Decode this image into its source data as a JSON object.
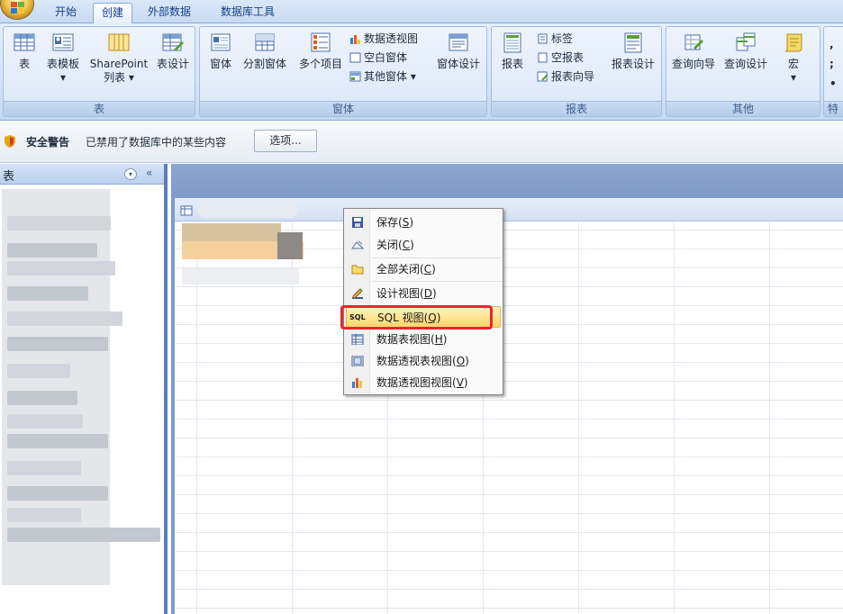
{
  "tabs": [
    {
      "label": "开始"
    },
    {
      "label": "创建"
    },
    {
      "label": "外部数据"
    },
    {
      "label": "数据库工具"
    }
  ],
  "ribbon": {
    "groups": [
      {
        "title": "表"
      },
      {
        "title": "窗体"
      },
      {
        "title": "报表"
      },
      {
        "title": "其他"
      },
      {
        "title": "特"
      }
    ],
    "table_group": {
      "table": "表",
      "table_template": "表模板",
      "table_template_arrow": "▾",
      "sharepoint_1": "SharePoint",
      "sharepoint_2": "列表 ▾",
      "table_design": "表设计"
    },
    "form_group": {
      "form": "窗体",
      "split_form": "分割窗体",
      "multi_items": "多个项目",
      "pivot_chart": "数据透视图",
      "blank_form": "空白窗体",
      "more_forms": "其他窗体 ▾",
      "form_design": "窗体设计"
    },
    "report_group": {
      "report": "报表",
      "labels": "标签",
      "blank_report": "空报表",
      "report_wizard": "报表向导",
      "report_design": "报表设计"
    },
    "other_group": {
      "query_wizard": "查询向导",
      "query_design": "查询设计",
      "macro": "宏",
      "macro_arrow": "▾"
    }
  },
  "message_bar": {
    "title": "安全警告",
    "text": "已禁用了数据库中的某些内容",
    "options": "选项..."
  },
  "nav_pane": {
    "title": "表",
    "dropdown": "▾",
    "collapse": "«"
  },
  "context_menu": {
    "items": [
      {
        "label": "保存",
        "key": "S",
        "icon": "save-icon"
      },
      {
        "label": "关闭",
        "key": "C",
        "icon": "close-doc-icon"
      },
      {
        "label": "全部关闭",
        "key": "C",
        "icon": "folder-icon"
      },
      {
        "label": "设计视图",
        "key": "D",
        "icon": "design-view-icon"
      },
      {
        "label": "SQL 视图",
        "key": "Q",
        "icon": "sql-icon",
        "icon_text": "SQL"
      },
      {
        "label": "数据表视图",
        "key": "H",
        "icon": "datasheet-icon"
      },
      {
        "label": "数据透视表视图",
        "key": "O",
        "icon": "pivot-table-icon"
      },
      {
        "label": "数据透视图视图",
        "key": "V",
        "icon": "pivot-chart-icon"
      }
    ],
    "highlighted_index": 4
  },
  "colors": {
    "highlight_border": "#e8262f",
    "ribbon_bg": "#dbe7f8",
    "workspace_bg": "#7f9bc7"
  }
}
